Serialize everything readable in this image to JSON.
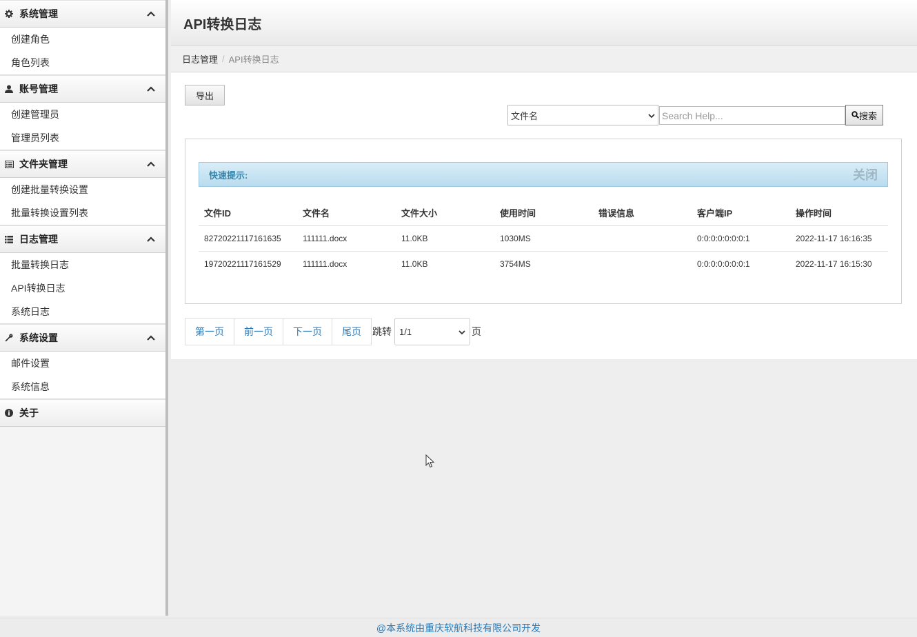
{
  "sidebar": {
    "groups": [
      {
        "title": "系统管理",
        "icon": "gear-icon",
        "items": [
          "创建角色",
          "角色列表"
        ]
      },
      {
        "title": "账号管理",
        "icon": "user-icon",
        "items": [
          "创建管理员",
          "管理员列表"
        ]
      },
      {
        "title": "文件夹管理",
        "icon": "list-alt-icon",
        "items": [
          "创建批量转换设置",
          "批量转换设置列表"
        ]
      },
      {
        "title": "日志管理",
        "icon": "list-icon",
        "items": [
          "批量转换日志",
          "API转换日志",
          "系统日志"
        ]
      },
      {
        "title": "系统设置",
        "icon": "wrench-icon",
        "items": [
          "邮件设置",
          "系统信息"
        ]
      },
      {
        "title": "关于",
        "icon": "info-icon",
        "items": []
      }
    ]
  },
  "header": {
    "title": "API转换日志"
  },
  "breadcrumb": {
    "parent": "日志管理",
    "separator": "/",
    "current": "API转换日志"
  },
  "toolbar": {
    "export_label": "导出",
    "search_field": "文件名",
    "search_placeholder": "Search Help...",
    "search_label": "搜索"
  },
  "hint": {
    "label": "快速提示:",
    "close_label": "关闭"
  },
  "table": {
    "columns": [
      "文件ID",
      "文件名",
      "文件大小",
      "使用时间",
      "错误信息",
      "客户端IP",
      "操作时间"
    ],
    "rows": [
      [
        "82720221117161635",
        "111111.docx",
        "11.0KB",
        "1030MS",
        "",
        "0:0:0:0:0:0:0:1",
        "2022-11-17 16:16:35"
      ],
      [
        "19720221117161529",
        "111111.docx",
        "11.0KB",
        "3754MS",
        "",
        "0:0:0:0:0:0:0:1",
        "2022-11-17 16:15:30"
      ]
    ]
  },
  "pager": {
    "first": "第一页",
    "prev": "前一页",
    "next": "下一页",
    "last": "尾页",
    "jump_label": "跳转",
    "page_value": "1/1",
    "page_unit": "页"
  },
  "footer": {
    "text": "@本系统由重庆软航科技有限公司开发"
  }
}
